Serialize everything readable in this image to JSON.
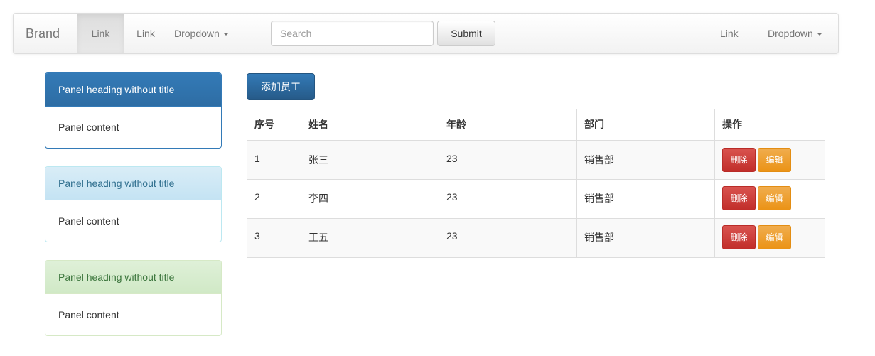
{
  "navbar": {
    "brand": "Brand",
    "links_left": [
      {
        "label": "Link",
        "active": true
      },
      {
        "label": "Link",
        "active": false
      }
    ],
    "dropdown_left": "Dropdown",
    "search_placeholder": "Search",
    "submit_label": "Submit",
    "link_right": "Link",
    "dropdown_right": "Dropdown"
  },
  "panels": [
    {
      "heading": "Panel heading without title",
      "content": "Panel content",
      "style": "primary"
    },
    {
      "heading": "Panel heading without title",
      "content": "Panel content",
      "style": "info"
    },
    {
      "heading": "Panel heading without title",
      "content": "Panel content",
      "style": "success"
    }
  ],
  "add_button_label": "添加员工",
  "table": {
    "headers": [
      "序号",
      "姓名",
      "年龄",
      "部门",
      "操作"
    ],
    "rows": [
      {
        "id": "1",
        "name": "张三",
        "age": "23",
        "dept": "销售部"
      },
      {
        "id": "2",
        "name": "李四",
        "age": "23",
        "dept": "销售部"
      },
      {
        "id": "3",
        "name": "王五",
        "age": "23",
        "dept": "销售部"
      }
    ],
    "delete_label": "删除",
    "edit_label": "编辑"
  },
  "colors": {
    "primary": "#337ab7",
    "info_bg": "#d9edf7",
    "success_bg": "#dff0d8",
    "danger": "#d9534f",
    "warning": "#f0ad4e"
  }
}
